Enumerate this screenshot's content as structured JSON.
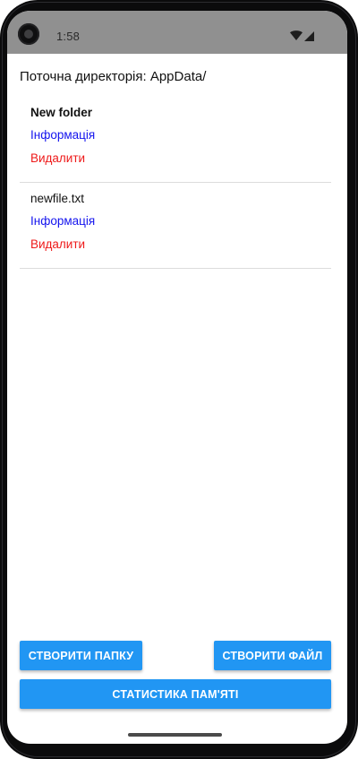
{
  "status_bar": {
    "time": "1:58",
    "icons": [
      "wifi-icon",
      "cellular-signal-icon"
    ],
    "background_color": "#909090"
  },
  "current_directory_label": "Поточна директорія: AppData/",
  "items": [
    {
      "name": "New folder",
      "is_folder": true,
      "info_label": "Інформація",
      "delete_label": "Видалити"
    },
    {
      "name": "newfile.txt",
      "is_folder": false,
      "info_label": "Інформація",
      "delete_label": "Видалити"
    }
  ],
  "buttons": {
    "create_folder": "Створити папку",
    "create_file": "Створити файл",
    "memory_stats": "Статистика пам'яті"
  },
  "colors": {
    "accent": "#2196f3",
    "info_link": "#1414ee",
    "delete_link": "#ee1a1a"
  }
}
